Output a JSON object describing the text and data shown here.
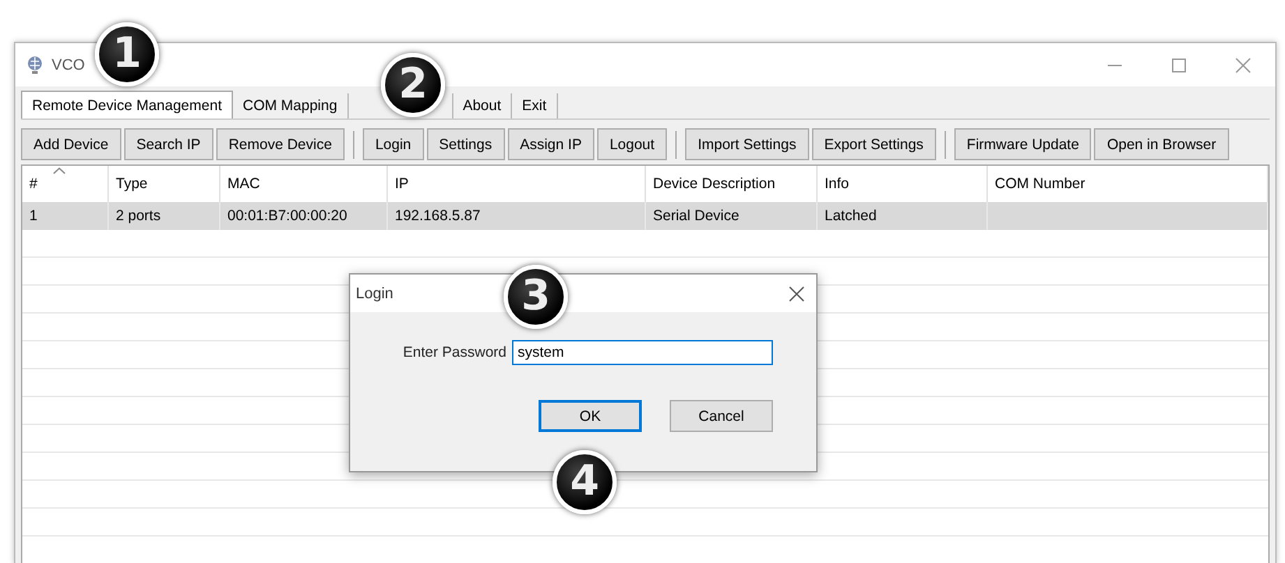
{
  "window": {
    "title": "VCO"
  },
  "tabs": [
    {
      "label": "Remote Device Management",
      "selected": true
    },
    {
      "label": "COM Mapping",
      "selected": false
    },
    {
      "label": "About",
      "selected": false
    },
    {
      "label": "Exit",
      "selected": false
    }
  ],
  "toolbar": [
    [
      "Add Device",
      "Search IP",
      "Remove Device"
    ],
    [
      "Login",
      "Settings",
      "Assign IP",
      "Logout"
    ],
    [
      "Import Settings",
      "Export Settings"
    ],
    [
      "Firmware Update",
      "Open in Browser"
    ]
  ],
  "table": {
    "columns": [
      "#",
      "Type",
      "MAC",
      "IP",
      "Device Description",
      "Info",
      "COM Number"
    ],
    "rows": [
      {
        "cells": [
          "1",
          "2 ports",
          "00:01:B7:00:00:20",
          "192.168.5.87",
          "Serial Device",
          "Latched",
          ""
        ],
        "selected": true
      }
    ]
  },
  "dialog": {
    "title": "Login",
    "field_label": "Enter Password",
    "value": "system",
    "buttons": [
      {
        "label": "OK",
        "default": true
      },
      {
        "label": "Cancel",
        "default": false
      }
    ]
  },
  "callouts": [
    "1",
    "2",
    "3",
    "4"
  ]
}
